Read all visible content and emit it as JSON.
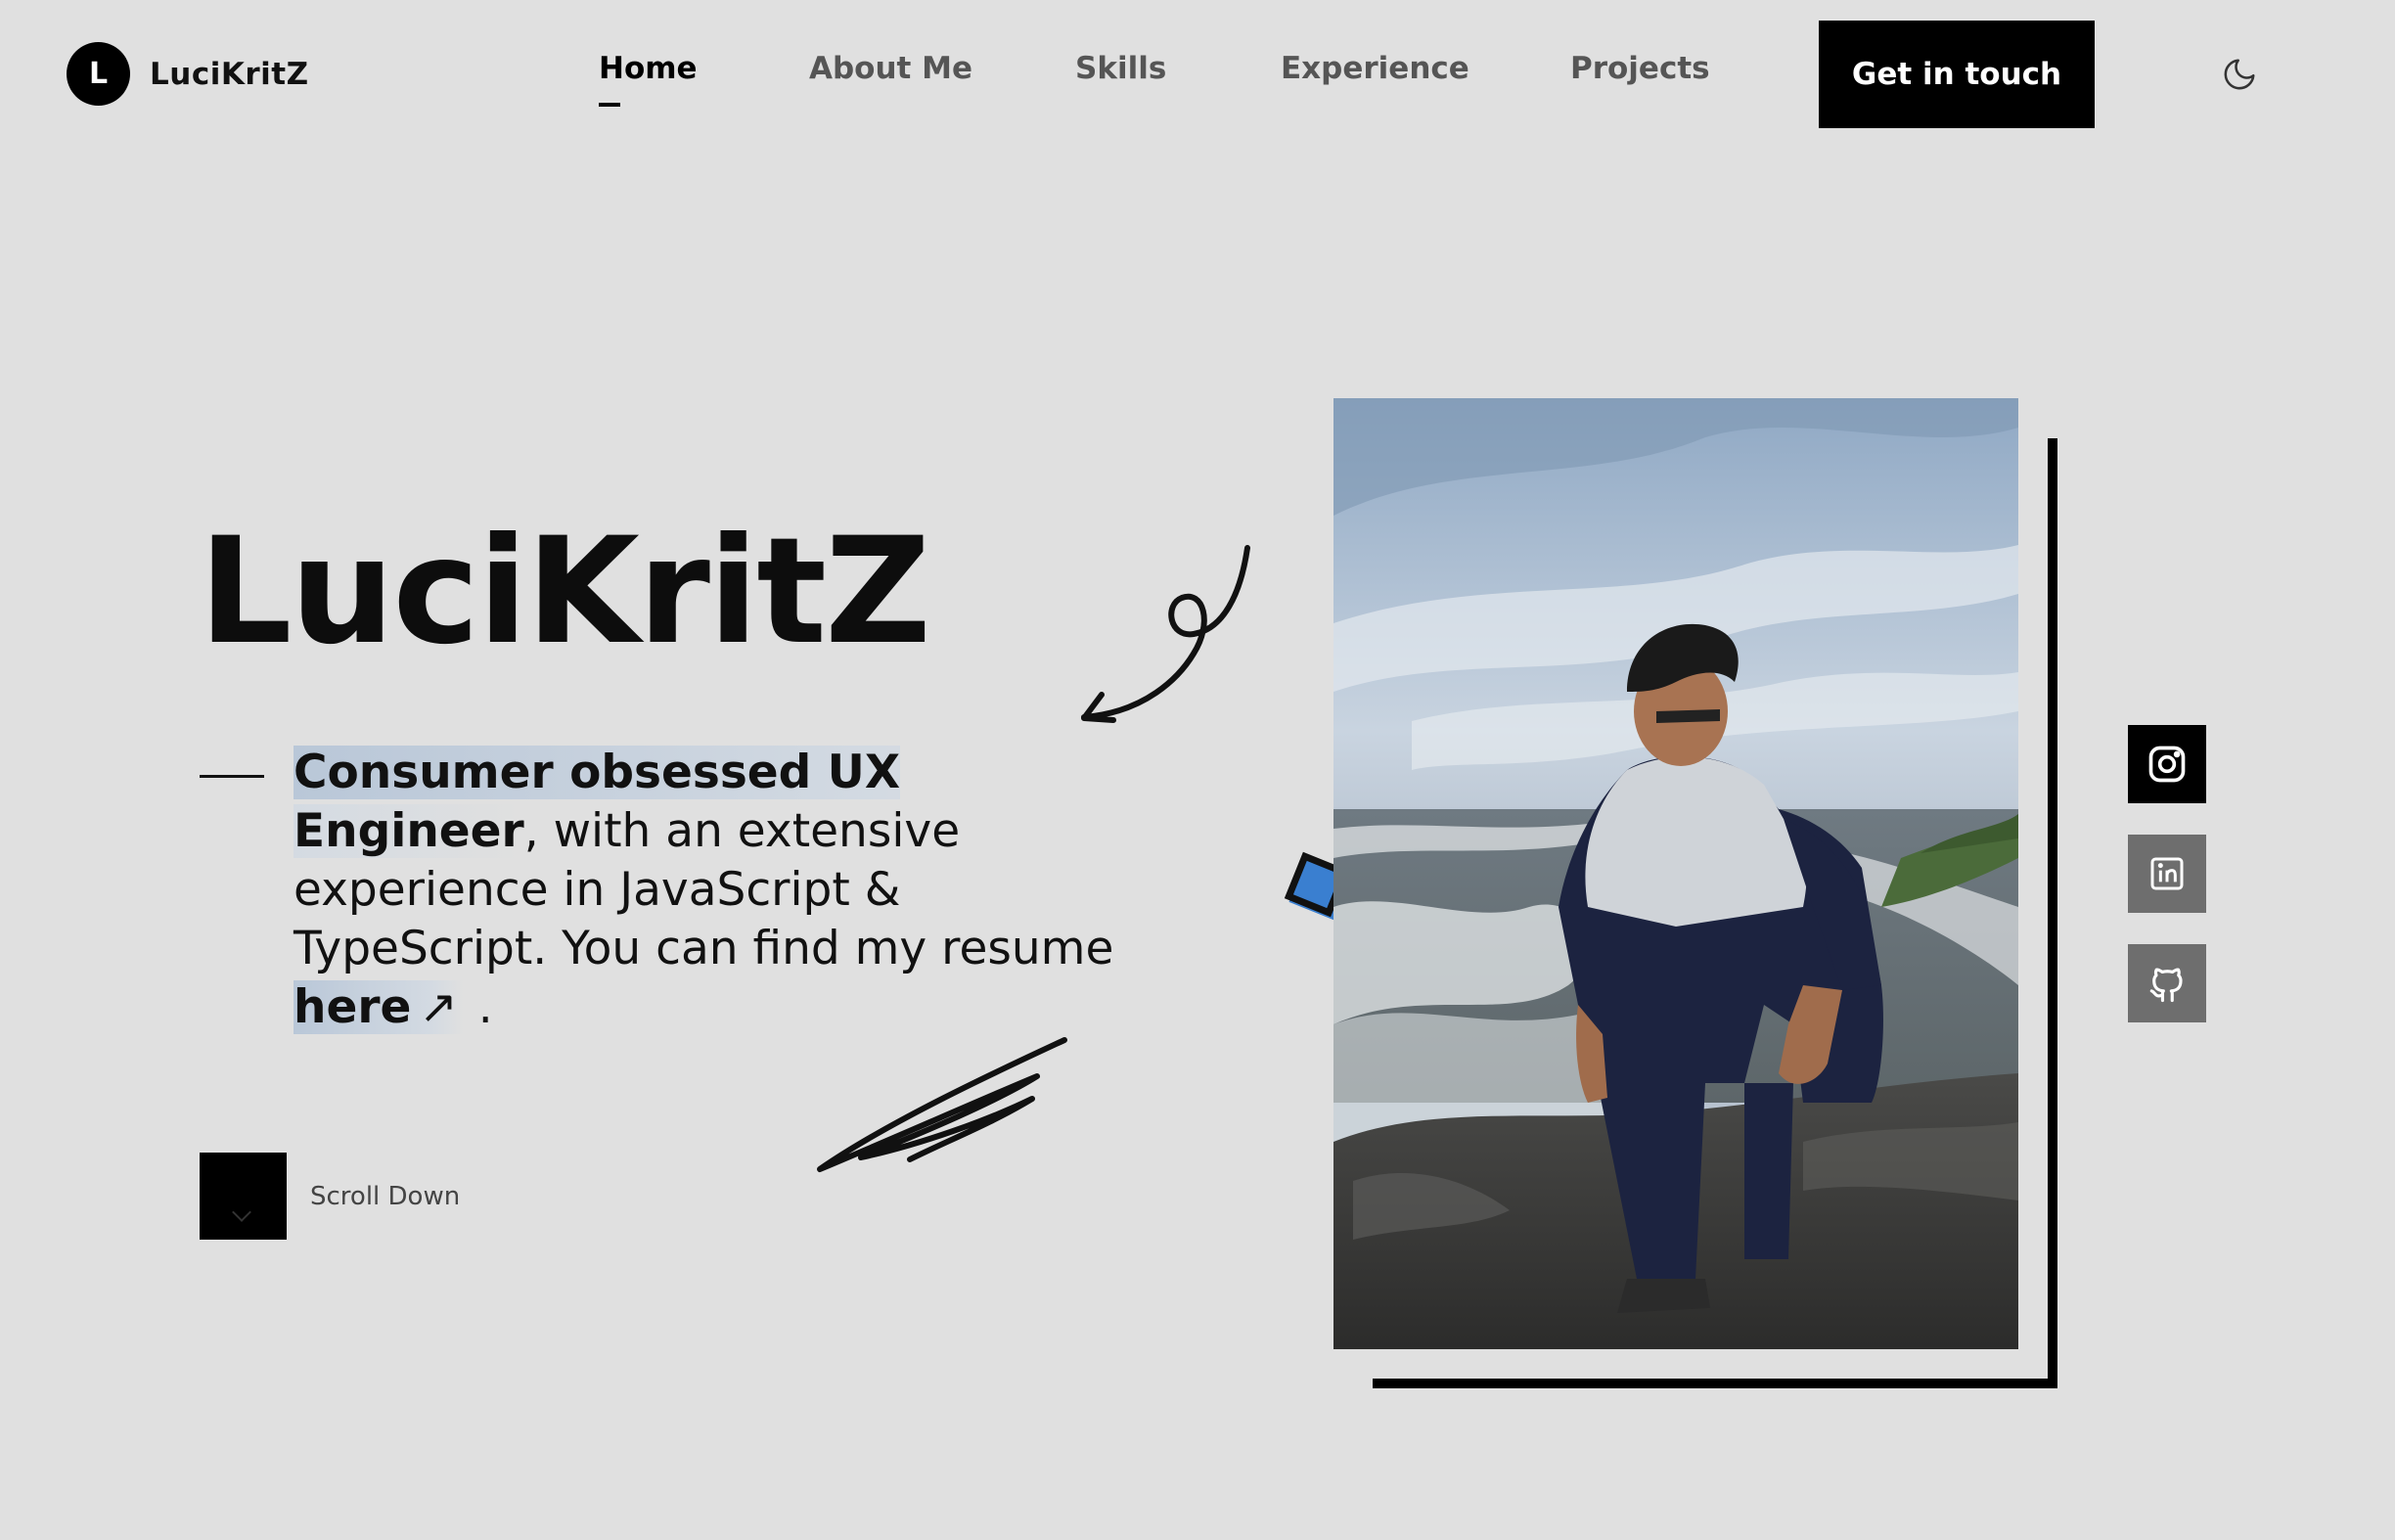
{
  "header": {
    "logo_initial": "L",
    "logo_text": "LuciKritZ",
    "nav": {
      "home": "Home",
      "about": "About Me",
      "skills": "Skills",
      "experience": "Experience",
      "projects": "Projects"
    },
    "active_nav": "Home",
    "cta_label": "Get in touch",
    "theme_icon": "moon-icon"
  },
  "hero": {
    "title": "LuciKritZ",
    "tagline_highlight": "Consumer obsessed UX Engineer",
    "tagline_comma": ",",
    "tagline_rest": " with an extensive experience in JavaScript & TypeScript. You can find my resume ",
    "resume_link": "here",
    "resume_link_icon": "arrow-up-right-icon",
    "tagline_end": " .",
    "highlight_color": "#b9c7d8"
  },
  "scroll": {
    "label": "Scroll Down",
    "icon": "chevron-down-icon"
  },
  "socials": [
    {
      "name": "instagram",
      "icon": "instagram-icon",
      "active": true
    },
    {
      "name": "linkedin",
      "icon": "linkedin-icon",
      "active": false
    },
    {
      "name": "github",
      "icon": "github-icon",
      "active": false
    }
  ],
  "colors": {
    "background": "#e0e0e0",
    "accent": "#000000",
    "diamond_fill": "#3a7fd0",
    "social_inactive": "#6e6e6e"
  }
}
